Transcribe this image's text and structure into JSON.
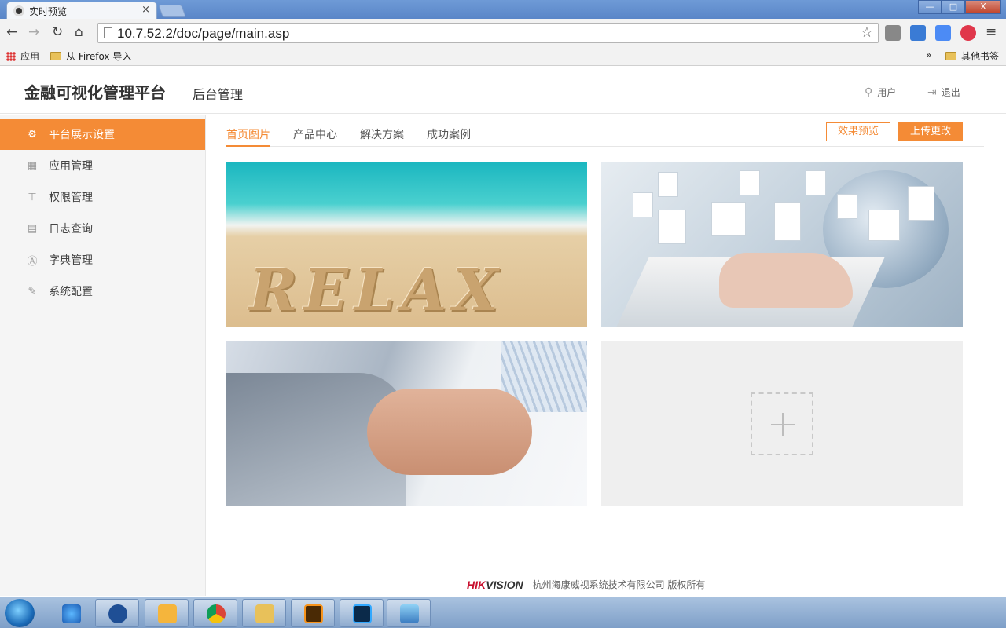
{
  "browser": {
    "tab_title": "实时预览",
    "tab_close": "×",
    "url": "10.7.52.2/doc/page/main.asp",
    "bookmarks": {
      "apps": "应用",
      "firefox_import": "从 Firefox 导入",
      "overflow": "»",
      "other": "其他书签"
    },
    "window_buttons": {
      "minimize": "—",
      "maximize": "□",
      "close": "X"
    }
  },
  "header": {
    "brand": "金融可视化管理平台",
    "subtitle": "后台管理",
    "user_label": "用户",
    "logout_label": "退出"
  },
  "sidebar": {
    "items": [
      {
        "label": "平台展示设置",
        "icon": "gear-icon",
        "active": true
      },
      {
        "label": "应用管理",
        "icon": "grid-icon",
        "active": false
      },
      {
        "label": "权限管理",
        "icon": "pin-icon",
        "active": false
      },
      {
        "label": "日志查询",
        "icon": "document-icon",
        "active": false
      },
      {
        "label": "字典管理",
        "icon": "dictionary-icon",
        "active": false
      },
      {
        "label": "系统配置",
        "icon": "wrench-icon",
        "active": false
      }
    ]
  },
  "content": {
    "tabs": [
      {
        "label": "首页图片",
        "active": true
      },
      {
        "label": "产品中心",
        "active": false
      },
      {
        "label": "解决方案",
        "active": false
      },
      {
        "label": "成功案例",
        "active": false
      }
    ],
    "preview_button": "效果预览",
    "upload_button": "上传更改",
    "beach_word": "RELAX"
  },
  "footer": {
    "logo_red": "HIK",
    "logo_dark": "VISION",
    "copyright": "杭州海康威视系统技术有限公司  版权所有"
  },
  "colors": {
    "accent": "#f48b36",
    "sidebar_bg": "#f5f5f5"
  }
}
